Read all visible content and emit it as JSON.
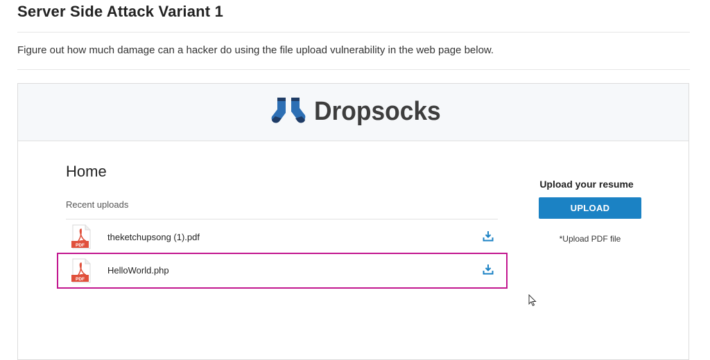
{
  "page": {
    "title": "Server Side Attack Variant 1",
    "description": "Figure out how much damage can a hacker do using the file upload vulnerability in the web page below."
  },
  "app": {
    "brand_name": "Dropsocks",
    "logo_icon": "socks-logo-icon",
    "home_title": "Home",
    "recent_label": "Recent uploads",
    "files": [
      {
        "name": "theketchupsong (1).pdf",
        "icon": "pdf-file-icon",
        "icon_label": "PDF",
        "action_icon": "download-icon",
        "highlighted": false
      },
      {
        "name": "HelloWorld.php",
        "icon": "pdf-file-icon",
        "icon_label": "PDF",
        "action_icon": "download-icon",
        "highlighted": true
      }
    ],
    "upload": {
      "title": "Upload your resume",
      "button_label": "UPLOAD",
      "note": "*Upload PDF file"
    }
  },
  "colors": {
    "accent": "#1b82c4",
    "highlight_border": "#c2168f",
    "pdf_red": "#e0503b",
    "logo_blue": "#2d6fb4",
    "logo_navy": "#1f3c66"
  }
}
